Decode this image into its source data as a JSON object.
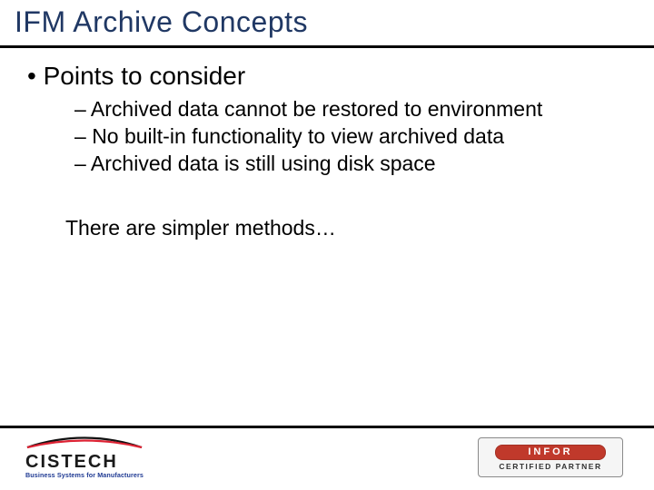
{
  "title": "IFM Archive Concepts",
  "heading": "Points to consider",
  "subpoints": [
    "Archived data cannot be restored to environment",
    "No built-in functionality to view archived data",
    "Archived data is still using disk space"
  ],
  "note": "There are simpler methods…",
  "logos": {
    "cistech": {
      "name": "CISTECH",
      "tagline": "Business Systems for Manufacturers"
    },
    "infor": {
      "name": "INFOR",
      "sub": "CERTIFIED PARTNER",
      "bar_color": "#c0392b"
    }
  }
}
